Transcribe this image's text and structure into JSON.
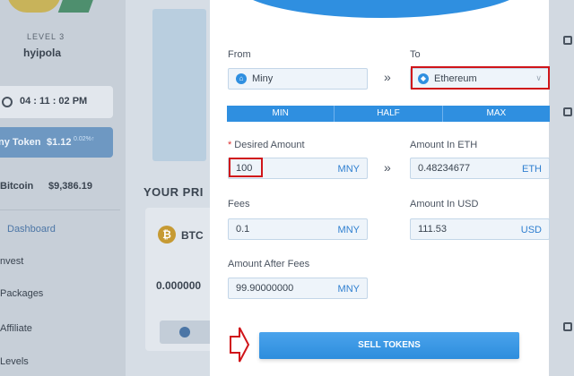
{
  "sidebar": {
    "level": "LEVEL 3",
    "username": "hyipola",
    "time": "04 : 11 : 02 PM",
    "token": {
      "name": "ny Token",
      "price": "$1.12",
      "change": "0.02%"
    },
    "bitcoin": {
      "name": "Bitcoin",
      "price": "$9,386.19"
    },
    "nav": [
      "Dashboard",
      "nvest",
      "Packages",
      "Affiliate",
      "Levels"
    ]
  },
  "main": {
    "section_title": "YOUR PRI",
    "btc_card": {
      "code": "BTC",
      "balance": "0.000000"
    }
  },
  "form": {
    "from_label": "From",
    "to_label": "To",
    "from_value": "Miny",
    "to_value": "Ethereum",
    "swap_arrow": "»",
    "tabs": [
      "MIN",
      "HALF",
      "MAX"
    ],
    "desired_label": "Desired Amount",
    "desired_value": "100",
    "desired_unit": "MNY",
    "eth_label": "Amount In ETH",
    "eth_value": "0.48234677",
    "eth_unit": "ETH",
    "fees_label": "Fees",
    "fees_value": "0.1",
    "fees_unit": "MNY",
    "usd_label": "Amount In USD",
    "usd_value": "111.53",
    "usd_unit": "USD",
    "after_label": "Amount After Fees",
    "after_value": "99.90000000",
    "after_unit": "MNY",
    "sell_label": "SELL TOKENS"
  },
  "colors": {
    "accent": "#2f8fe0",
    "highlight": "#d0151a"
  }
}
